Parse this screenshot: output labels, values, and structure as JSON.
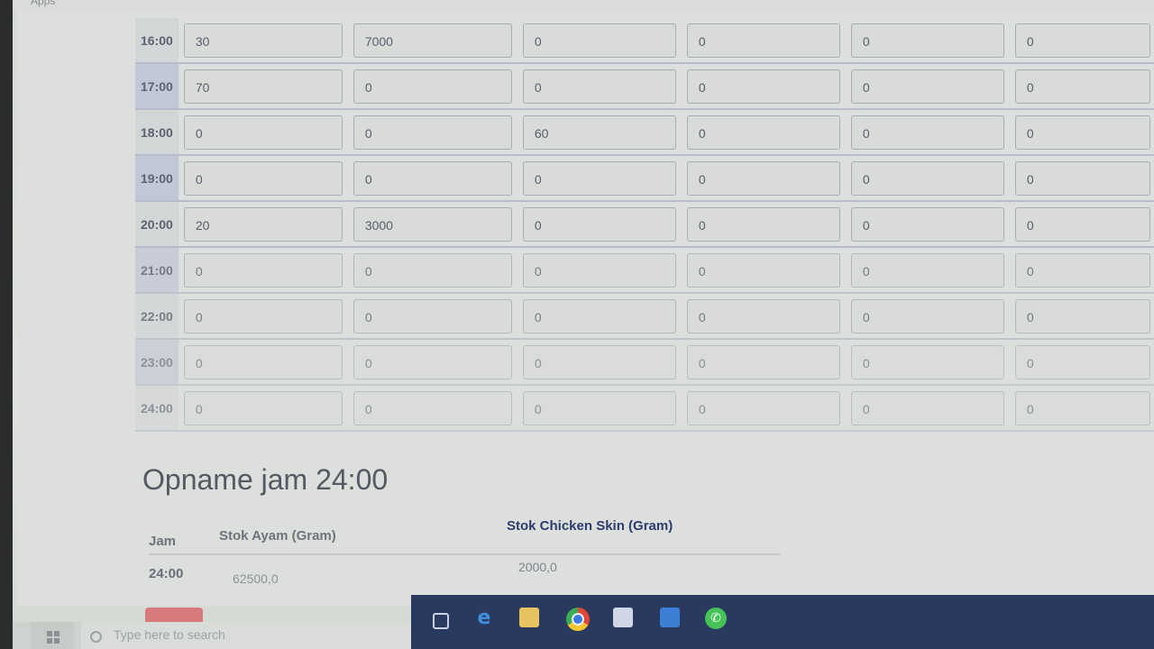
{
  "browser": {
    "bookmark_apps_label": "Apps"
  },
  "hourly_table": {
    "rows": [
      {
        "time": "16:00",
        "values": [
          "30",
          "7000",
          "0",
          "0",
          "0",
          "0"
        ]
      },
      {
        "time": "17:00",
        "values": [
          "70",
          "0",
          "0",
          "0",
          "0",
          "0"
        ]
      },
      {
        "time": "18:00",
        "values": [
          "0",
          "0",
          "60",
          "0",
          "0",
          "0"
        ]
      },
      {
        "time": "19:00",
        "values": [
          "0",
          "0",
          "0",
          "0",
          "0",
          "0"
        ]
      },
      {
        "time": "20:00",
        "values": [
          "20",
          "3000",
          "0",
          "0",
          "0",
          "0"
        ]
      },
      {
        "time": "21:00",
        "values": [
          "0",
          "0",
          "0",
          "0",
          "0",
          "0"
        ]
      },
      {
        "time": "22:00",
        "values": [
          "0",
          "0",
          "0",
          "0",
          "0",
          "0"
        ]
      },
      {
        "time": "23:00",
        "values": [
          "0",
          "0",
          "0",
          "0",
          "0",
          "0"
        ]
      },
      {
        "time": "24:00",
        "values": [
          "0",
          "0",
          "0",
          "0",
          "0",
          "0"
        ]
      }
    ]
  },
  "opname": {
    "title": "Opname jam 24:00",
    "headers": {
      "jam": "Jam",
      "stok_ayam": "Stok Ayam (Gram)",
      "stok_chicken_skin": "Stok Chicken Skin (Gram)"
    },
    "row": {
      "jam": "24:00",
      "stok_ayam": "62500,0",
      "stok_chicken_skin": "2000,0"
    }
  },
  "taskbar": {
    "search_placeholder": "Type here to search",
    "icons": [
      "task-view-icon",
      "edge-icon",
      "file-explorer-icon",
      "chrome-icon",
      "store-icon",
      "mail-icon",
      "whatsapp-icon"
    ]
  }
}
